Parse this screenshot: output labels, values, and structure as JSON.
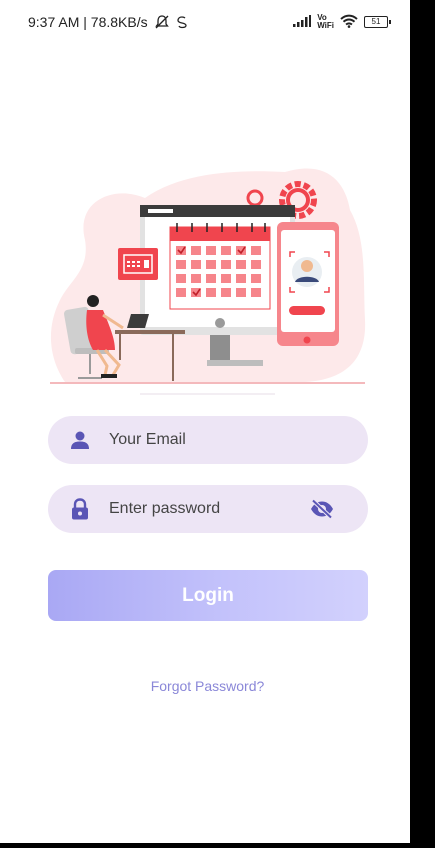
{
  "status_bar": {
    "time_network": "9:37 AM | 78.8KB/s",
    "volte": "Vo",
    "wifi_label": "WiFi",
    "battery": "51"
  },
  "illustration": {
    "description_icon": "scheduling-illustration-icon"
  },
  "email_field": {
    "placeholder": "Your Email",
    "icon": "person-icon"
  },
  "password_field": {
    "placeholder": "Enter password",
    "icon": "lock-icon",
    "toggle_icon": "eye-off-icon"
  },
  "login_button": {
    "label": "Login"
  },
  "forgot_password": {
    "label": "Forgot Password?"
  },
  "colors": {
    "field_bg": "#ede5f5",
    "icon_accent": "#5a55b5",
    "button_gradient_start": "#a9a8f4",
    "button_gradient_end": "#d2d1fd",
    "link": "#8a87d8",
    "illustration_red": "#f0454e"
  }
}
